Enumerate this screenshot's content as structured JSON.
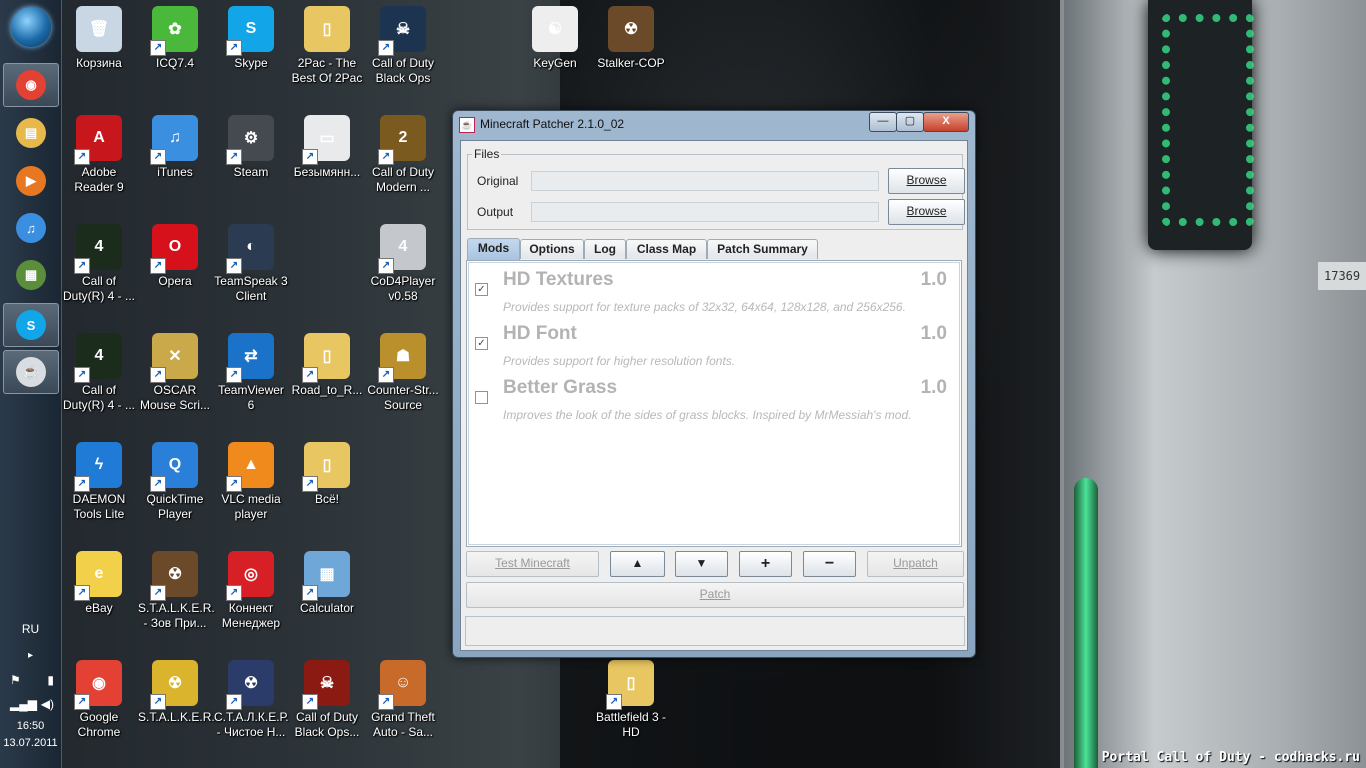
{
  "taskbar": {
    "pinned": [
      {
        "name": "chrome-icon",
        "color": "#e34133",
        "glyph": "◉"
      },
      {
        "name": "explorer-icon",
        "color": "#e7b84a",
        "glyph": "▤"
      },
      {
        "name": "media-player-icon",
        "color": "#e87722",
        "glyph": "▶"
      },
      {
        "name": "itunes-icon",
        "color": "#3b8fe0",
        "glyph": "♫"
      },
      {
        "name": "minecraft-icon",
        "color": "#5b8e3a",
        "glyph": "▦"
      },
      {
        "name": "skype-icon",
        "color": "#12a5e8",
        "glyph": "S"
      },
      {
        "name": "java-icon",
        "color": "#d9dde2",
        "glyph": "☕"
      }
    ],
    "language": "RU",
    "time": "16:50",
    "date": "13.07.2011"
  },
  "desktop_icons": [
    {
      "label": "Корзина",
      "icon": "recycle-bin-icon",
      "color": "#c9d6e3",
      "glyph": "🗑"
    },
    {
      "label": "ICQ7.4",
      "icon": "icq-icon",
      "color": "#4ab83a",
      "glyph": "✿"
    },
    {
      "label": "Skype",
      "icon": "skype-icon",
      "color": "#12a5e8",
      "glyph": "S"
    },
    {
      "label": "2Pac - The Best Of 2Pac",
      "icon": "folder-icon",
      "color": "#e8c662",
      "glyph": "▯"
    },
    {
      "label": "Call of Duty Black Ops",
      "icon": "black-ops-icon",
      "color": "#1d3450",
      "glyph": "☠"
    },
    {
      "label": "KeyGen",
      "icon": "keygen-icon",
      "color": "#eeeeee",
      "glyph": "☯"
    },
    {
      "label": "Stalker-COP",
      "icon": "radiation-icon",
      "color": "#6b4a2a",
      "glyph": "☢"
    },
    {
      "label": "Adobe Reader 9",
      "icon": "adobe-reader-icon",
      "color": "#c8161d",
      "glyph": "A"
    },
    {
      "label": "iTunes",
      "icon": "itunes-icon",
      "color": "#3b8fe0",
      "glyph": "♫"
    },
    {
      "label": "Steam",
      "icon": "steam-icon",
      "color": "#444a50",
      "glyph": "⚙"
    },
    {
      "label": "Безымянн...",
      "icon": "document-icon",
      "color": "#e8eaec",
      "glyph": "▭"
    },
    {
      "label": "Call of Duty Modern ...",
      "icon": "modern-warfare-2-icon",
      "color": "#7a5a1e",
      "glyph": "2"
    },
    {
      "label": "Call of Duty(R) 4 - ...",
      "icon": "cod4-icon",
      "color": "#1c2c1c",
      "glyph": "4"
    },
    {
      "label": "Opera",
      "icon": "opera-icon",
      "color": "#d6111b",
      "glyph": "O"
    },
    {
      "label": "TeamSpeak 3 Client",
      "icon": "teamspeak-icon",
      "color": "#2b3c52",
      "glyph": "◐"
    },
    {
      "label": "CoD4Player v0.58",
      "icon": "cod4player-icon",
      "color": "#c4c8cc",
      "glyph": "4"
    },
    {
      "label": "Call of Duty(R) 4 - ...",
      "icon": "cod4-icon",
      "color": "#1c2c1c",
      "glyph": "4"
    },
    {
      "label": "OSCAR Mouse Scri...",
      "icon": "oscar-icon",
      "color": "#c9a94a",
      "glyph": "✕"
    },
    {
      "label": "TeamViewer 6",
      "icon": "teamviewer-icon",
      "color": "#1a73c9",
      "glyph": "⇄"
    },
    {
      "label": "Road_to_R...",
      "icon": "folder-icon",
      "color": "#e8c662",
      "glyph": "▯"
    },
    {
      "label": "Counter-Str... Source",
      "icon": "counter-strike-icon",
      "color": "#b9902c",
      "glyph": "☗"
    },
    {
      "label": "DAEMON Tools Lite",
      "icon": "daemon-tools-icon",
      "color": "#1f7bd6",
      "glyph": "ϟ"
    },
    {
      "label": "QuickTime Player",
      "icon": "quicktime-icon",
      "color": "#2a7fd8",
      "glyph": "Q"
    },
    {
      "label": "VLC media player",
      "icon": "vlc-icon",
      "color": "#f08a1c",
      "glyph": "▲"
    },
    {
      "label": "Всё!",
      "icon": "folder-icon",
      "color": "#e8c662",
      "glyph": "▯"
    },
    {
      "label": "eBay",
      "icon": "ebay-icon",
      "color": "#f2d04a",
      "glyph": "e"
    },
    {
      "label": "S.T.A.L.K.E.R. - Зов При...",
      "icon": "radiation-icon",
      "color": "#6b4a2a",
      "glyph": "☢"
    },
    {
      "label": "Коннект Менеджер",
      "icon": "connect-manager-icon",
      "color": "#d71f26",
      "glyph": "◎"
    },
    {
      "label": "Calculator",
      "icon": "calculator-icon",
      "color": "#6fa7d9",
      "glyph": "▦"
    },
    {
      "label": "Google Chrome",
      "icon": "chrome-icon",
      "color": "#e34133",
      "glyph": "◉"
    },
    {
      "label": "S.T.A.L.K.E.R.",
      "icon": "radiation-icon",
      "color": "#d9b42c",
      "glyph": "☢"
    },
    {
      "label": "С.Т.А.Л.К.Е.Р. - Чистое Н...",
      "icon": "radiation-icon",
      "color": "#2b3c6a",
      "glyph": "☢"
    },
    {
      "label": "Call of Duty Black Ops...",
      "icon": "black-ops-icon",
      "color": "#8a1a12",
      "glyph": "☠"
    },
    {
      "label": "Grand Theft Auto - Sa...",
      "icon": "gta-icon",
      "color": "#c76a2a",
      "glyph": "☺"
    },
    {
      "label": "Battlefield 3 - HD",
      "icon": "folder-icon",
      "color": "#e8c662",
      "glyph": "▯"
    }
  ],
  "window": {
    "title": "Minecraft Patcher 2.1.0_02",
    "controls": {
      "minimize": "—",
      "maximize": "▢",
      "close": "X"
    },
    "files": {
      "legend": "Files",
      "original_label": "Original",
      "output_label": "Output",
      "browse_label": "Browse"
    },
    "tabs": [
      "Mods",
      "Options",
      "Log",
      "Class Map",
      "Patch Summary"
    ],
    "selected_tab": "Mods",
    "mods": [
      {
        "name": "HD Textures",
        "version": "1.0",
        "checked": true,
        "description": "Provides support for texture packs of 32x32, 64x64, 128x128, and 256x256."
      },
      {
        "name": "HD Font",
        "version": "1.0",
        "checked": true,
        "description": "Provides support for higher resolution fonts."
      },
      {
        "name": "Better Grass",
        "version": "1.0",
        "checked": false,
        "description": "Improves the look of the sides of grass blocks. Inspired by MrMessiah's mod."
      }
    ],
    "buttons": {
      "test": "Test Minecraft",
      "up": "▲",
      "down": "▼",
      "add": "+",
      "remove": "−",
      "unpatch": "Unpatch",
      "patch": "Patch"
    }
  },
  "watermark": "Portal Call of Duty - codhacks.ru"
}
